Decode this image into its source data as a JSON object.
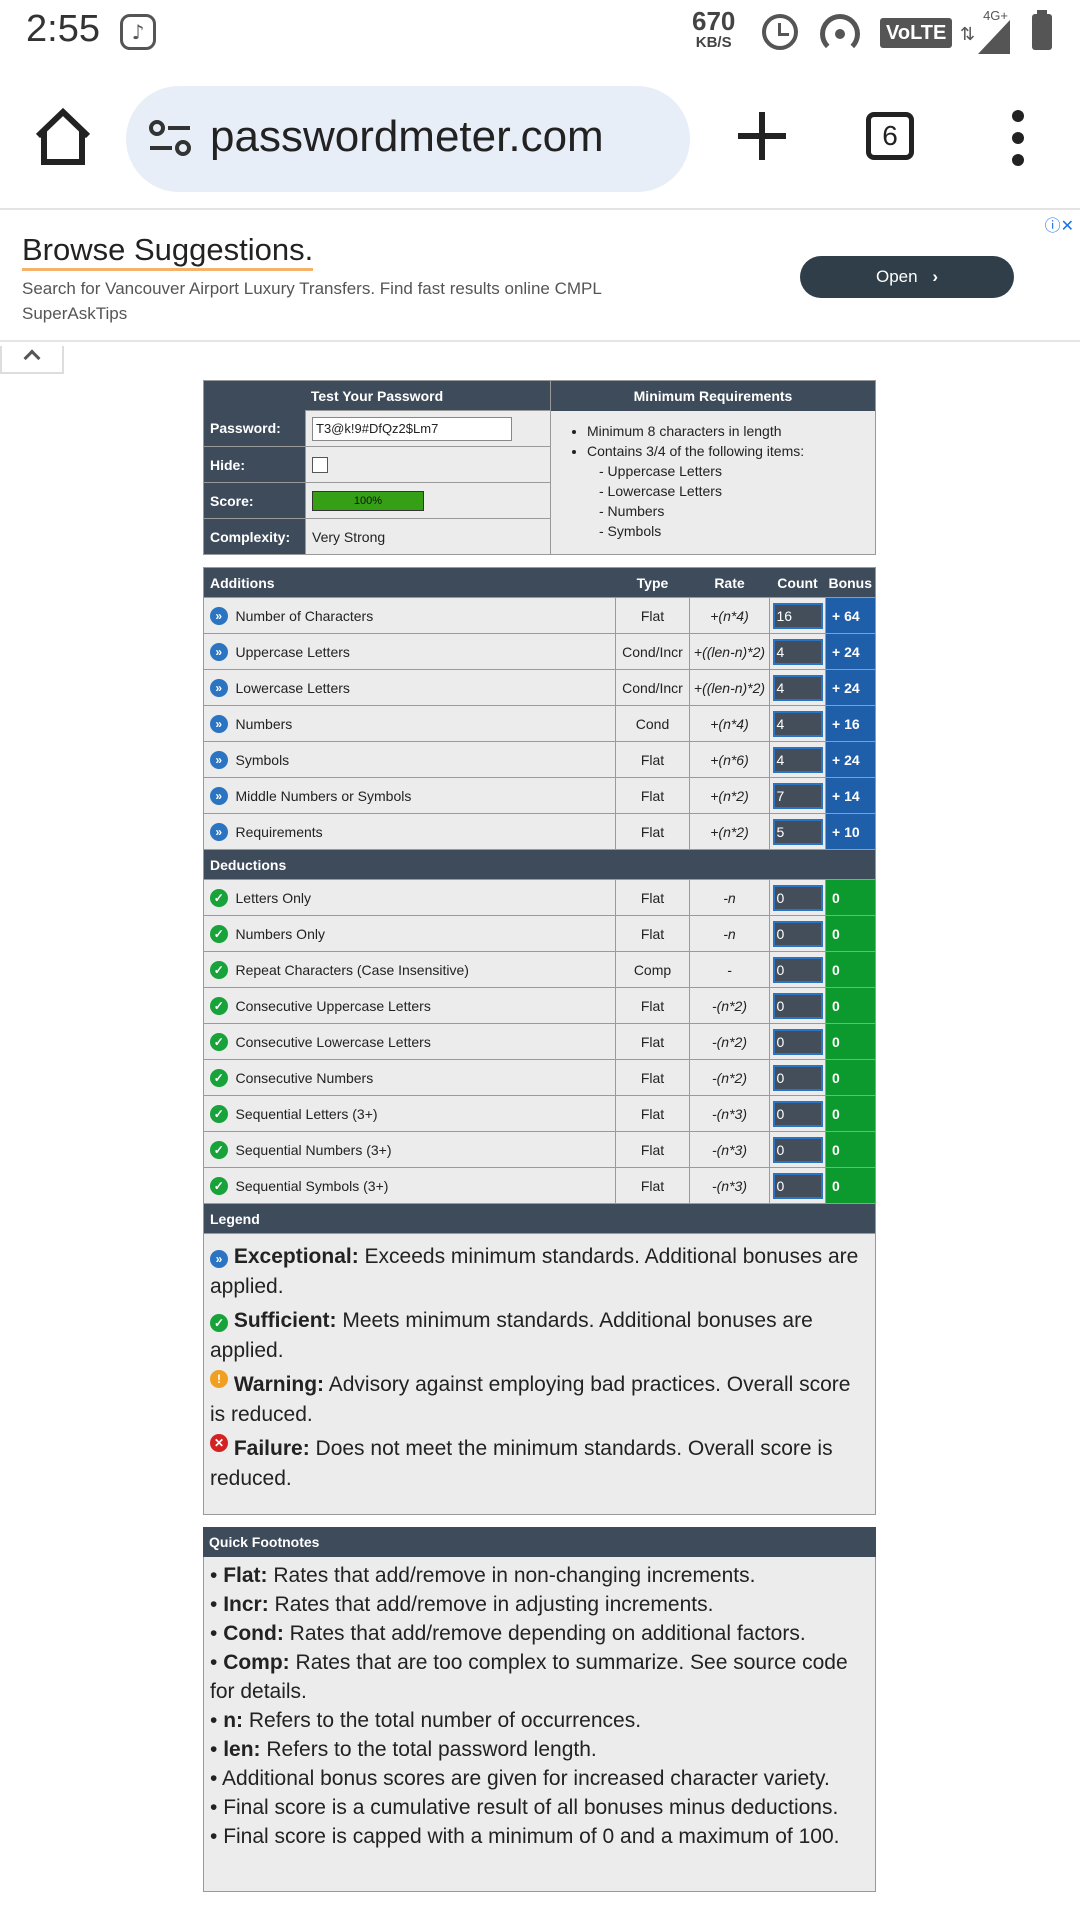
{
  "status_bar": {
    "time": "2:55",
    "speed_value": "670",
    "speed_unit": "KB/S",
    "volte": "VoLTE",
    "network": "4G+"
  },
  "browser": {
    "url": "passwordmeter.com",
    "tab_count": "6"
  },
  "ad": {
    "title": "Browse Suggestions.",
    "description": "Search for Vancouver Airport Luxury Transfers. Find fast results online CMPL SuperAskTips",
    "open_label": "Open"
  },
  "test": {
    "header_left": "Test Your Password",
    "header_right": "Minimum Requirements",
    "password_label": "Password:",
    "password_value": "T3@k!9#DfQz2$Lm7",
    "hide_label": "Hide:",
    "score_label": "Score:",
    "score_value": "100%",
    "complexity_label": "Complexity:",
    "complexity_value": "Very Strong",
    "requirements": [
      "Minimum 8 characters in length",
      "Contains 3/4 of the following items:"
    ],
    "sub_requirements": [
      "- Uppercase Letters",
      "- Lowercase Letters",
      "- Numbers",
      "- Symbols"
    ]
  },
  "table": {
    "headers": {
      "additions": "Additions",
      "type": "Type",
      "rate": "Rate",
      "count": "Count",
      "bonus": "Bonus"
    },
    "deductions_label": "Deductions",
    "legend_label": "Legend",
    "additions": [
      {
        "name": "Number of Characters",
        "type": "Flat",
        "rate": "+(n*4)",
        "count": "16",
        "bonus": "+ 64"
      },
      {
        "name": "Uppercase Letters",
        "type": "Cond/Incr",
        "rate": "+((len-n)*2)",
        "count": "4",
        "bonus": "+ 24"
      },
      {
        "name": "Lowercase Letters",
        "type": "Cond/Incr",
        "rate": "+((len-n)*2)",
        "count": "4",
        "bonus": "+ 24"
      },
      {
        "name": "Numbers",
        "type": "Cond",
        "rate": "+(n*4)",
        "count": "4",
        "bonus": "+ 16"
      },
      {
        "name": "Symbols",
        "type": "Flat",
        "rate": "+(n*6)",
        "count": "4",
        "bonus": "+ 24"
      },
      {
        "name": "Middle Numbers or Symbols",
        "type": "Flat",
        "rate": "+(n*2)",
        "count": "7",
        "bonus": "+ 14"
      },
      {
        "name": "Requirements",
        "type": "Flat",
        "rate": "+(n*2)",
        "count": "5",
        "bonus": "+ 10"
      }
    ],
    "deductions": [
      {
        "name": "Letters Only",
        "type": "Flat",
        "rate": "-n",
        "count": "0",
        "bonus": "0"
      },
      {
        "name": "Numbers Only",
        "type": "Flat",
        "rate": "-n",
        "count": "0",
        "bonus": "0"
      },
      {
        "name": "Repeat Characters (Case Insensitive)",
        "type": "Comp",
        "rate": "-",
        "count": "0",
        "bonus": "0"
      },
      {
        "name": "Consecutive Uppercase Letters",
        "type": "Flat",
        "rate": "-(n*2)",
        "count": "0",
        "bonus": "0"
      },
      {
        "name": "Consecutive Lowercase Letters",
        "type": "Flat",
        "rate": "-(n*2)",
        "count": "0",
        "bonus": "0"
      },
      {
        "name": "Consecutive Numbers",
        "type": "Flat",
        "rate": "-(n*2)",
        "count": "0",
        "bonus": "0"
      },
      {
        "name": "Sequential Letters (3+)",
        "type": "Flat",
        "rate": "-(n*3)",
        "count": "0",
        "bonus": "0"
      },
      {
        "name": "Sequential Numbers (3+)",
        "type": "Flat",
        "rate": "-(n*3)",
        "count": "0",
        "bonus": "0"
      },
      {
        "name": "Sequential Symbols (3+)",
        "type": "Flat",
        "rate": "-(n*3)",
        "count": "0",
        "bonus": "0"
      }
    ]
  },
  "legend": [
    {
      "term": "Exceptional:",
      "text": " Exceeds minimum standards. Additional bonuses are applied."
    },
    {
      "term": "Sufficient:",
      "text": " Meets minimum standards. Additional bonuses are applied."
    },
    {
      "term": "Warning:",
      "text": " Advisory against employing bad practices. Overall score is reduced."
    },
    {
      "term": "Failure:",
      "text": " Does not meet the minimum standards. Overall score is reduced."
    }
  ],
  "footnotes": {
    "title": "Quick Footnotes",
    "items": [
      {
        "term": "Flat:",
        "text": " Rates that add/remove in non-changing increments."
      },
      {
        "term": "Incr:",
        "text": " Rates that add/remove in adjusting increments."
      },
      {
        "term": "Cond:",
        "text": " Rates that add/remove depending on additional factors."
      },
      {
        "term": "Comp:",
        "text": " Rates that are too complex to summarize. See source code for details."
      },
      {
        "term": "n:",
        "text": " Refers to the total number of occurrences."
      },
      {
        "term": "len:",
        "text": " Refers to the total password length."
      },
      {
        "term": "",
        "text": "Additional bonus scores are given for increased character variety."
      },
      {
        "term": "",
        "text": "Final score is a cumulative result of all bonuses minus deductions."
      },
      {
        "term": "",
        "text": "Final score is capped with a minimum of 0 and a maximum of 100."
      }
    ]
  },
  "colors": {
    "header_bg": "#3e4b5a",
    "bonus_blue": "#1f5ea8",
    "bonus_green": "#0c9a2e",
    "score_bar": "#35a015"
  }
}
